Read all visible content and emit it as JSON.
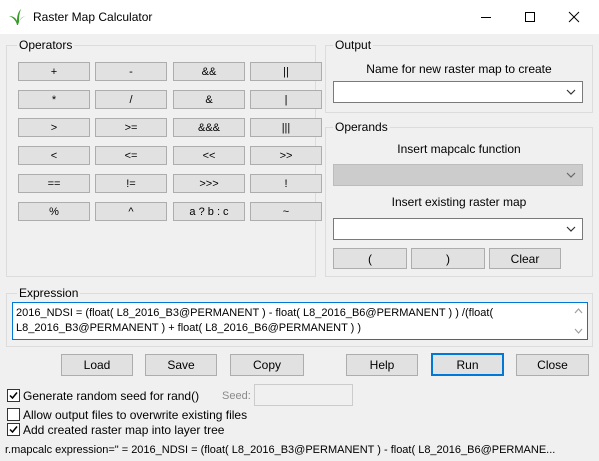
{
  "window": {
    "title": "Raster Map Calculator",
    "icons": {
      "app": "grass-leaf-icon",
      "minimize": "minimize-icon",
      "maximize": "maximize-icon",
      "close": "close-icon"
    }
  },
  "operators": {
    "title": "Operators",
    "buttons": [
      "+",
      "-",
      "&&",
      "||",
      "*",
      "/",
      "&",
      "|",
      ">",
      ">=",
      "&&&",
      "|||",
      "<",
      "<=",
      "<<",
      ">>",
      "==",
      "!=",
      ">>>",
      "!",
      "%",
      "^",
      "a ? b : c",
      "~"
    ]
  },
  "output": {
    "title": "Output",
    "name_label": "Name for new raster map to create",
    "name_value": ""
  },
  "operands": {
    "title": "Operands",
    "function_label": "Insert mapcalc function",
    "function_value": "",
    "raster_label": "Insert existing raster map",
    "raster_value": "",
    "open_paren": "(",
    "close_paren": ")",
    "clear": "Clear"
  },
  "expression": {
    "title": "Expression",
    "text": "2016_NDSI = (float( L8_2016_B3@PERMANENT ) - float( L8_2016_B6@PERMANENT ) ) /(float( L8_2016_B3@PERMANENT ) + float( L8_2016_B6@PERMANENT ) )"
  },
  "actions": {
    "load": "Load",
    "save": "Save",
    "copy": "Copy",
    "help": "Help",
    "run": "Run",
    "close": "Close"
  },
  "options": {
    "seed_label": "Generate random seed for rand()",
    "seed_checked": true,
    "seed_field_label": "Seed:",
    "seed_value": "",
    "overwrite_label": "Allow output files to overwrite existing files",
    "overwrite_checked": false,
    "add_label": "Add created raster map into layer tree",
    "add_checked": true
  },
  "status": {
    "text": "r.mapcalc expression=\" = 2016_NDSI = (float( L8_2016_B3@PERMANENT ) - float( L8_2016_B6@PERMANE..."
  },
  "colors": {
    "accent": "#0078d7",
    "window_bg": "#f0f0f0",
    "button_bg": "#e1e1e1",
    "button_border": "#adadad",
    "disabled_bg": "#cccccc"
  }
}
